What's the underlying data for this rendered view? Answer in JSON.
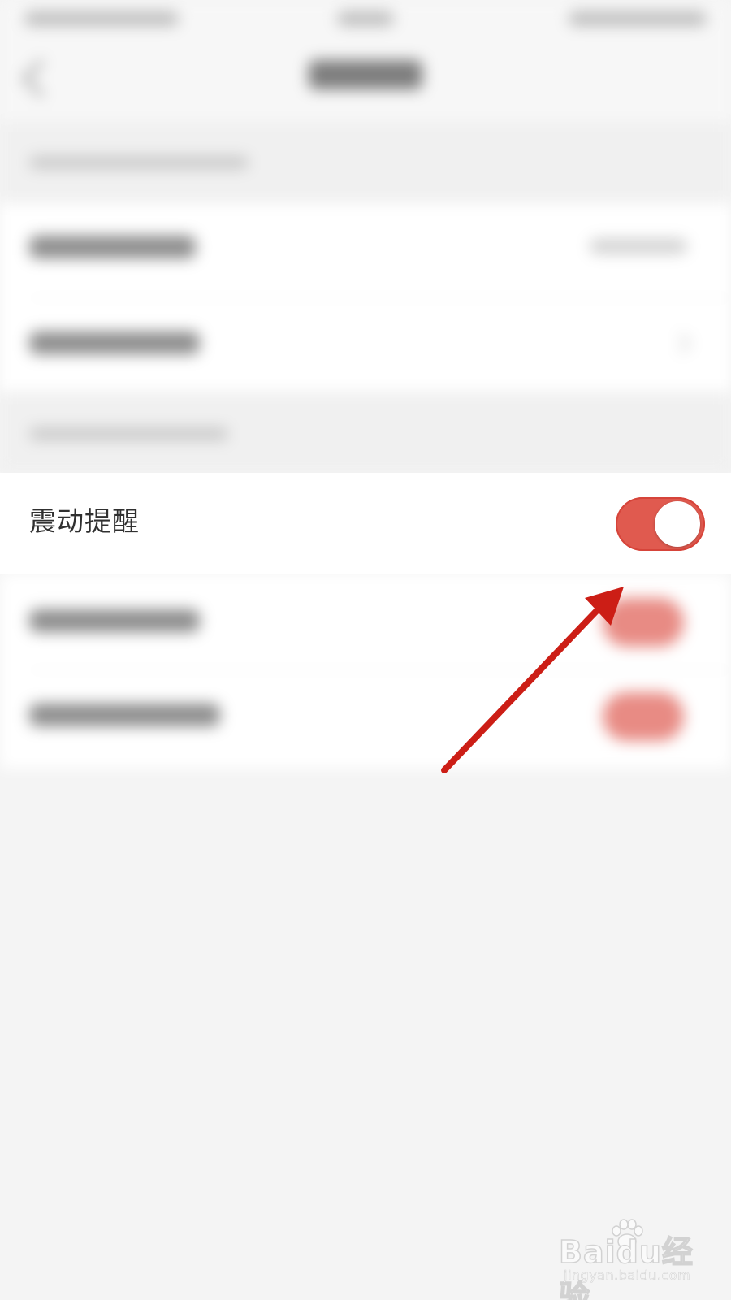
{
  "settings": {
    "vibration_reminder": {
      "label": "震动提醒",
      "enabled": true
    }
  },
  "colors": {
    "accent": "#e05a4f",
    "page_background": "#f4f4f4",
    "card_background": "#ffffff",
    "annotation_arrow": "#cc1e16"
  },
  "annotation": {
    "type": "arrow",
    "target": "vibration-reminder-toggle"
  },
  "watermark": {
    "brand": "Baidu经验",
    "url": "jingyan.baidu.com"
  }
}
